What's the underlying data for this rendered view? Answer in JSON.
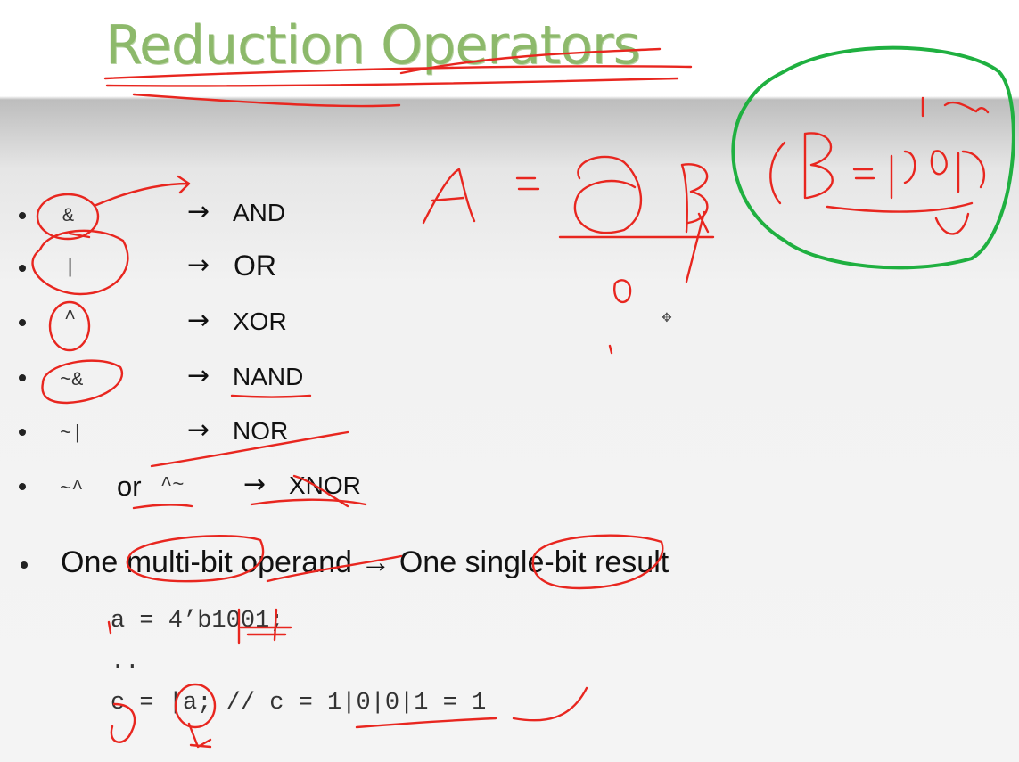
{
  "slide": {
    "title": "Reduction Operators",
    "operators": [
      {
        "symbol": "&",
        "arrow": "→",
        "name": "AND"
      },
      {
        "symbol": "|",
        "arrow": "→",
        "name": "OR"
      },
      {
        "symbol": "^",
        "arrow": "→",
        "name": "XOR"
      },
      {
        "symbol": "~&",
        "arrow": "→",
        "name": "NAND"
      },
      {
        "symbol": "~|",
        "arrow": "→",
        "name": "NOR"
      }
    ],
    "xnor": {
      "symbol_a": "~^",
      "or_word": "or",
      "symbol_b": "^~",
      "arrow": "→",
      "name": "XNOR"
    },
    "rule": "One multi-bit operand → One single-bit result",
    "code": [
      "a = 4’b1001;",
      "..",
      "c = |a; // c = 1|0|0|1 = 1"
    ]
  },
  "colors": {
    "title": "#8db96b",
    "annotation": "#e8261f",
    "highlight_circle": "#1fb040"
  }
}
